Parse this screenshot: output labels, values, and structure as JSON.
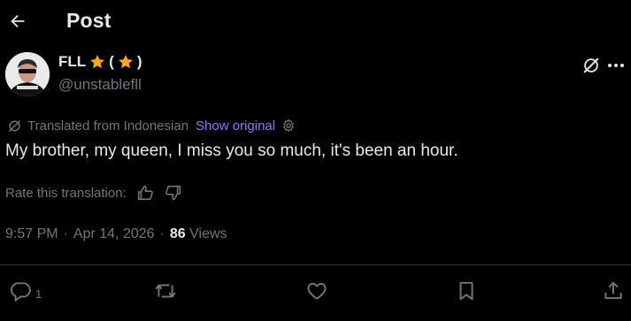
{
  "header": {
    "title": "Post"
  },
  "author": {
    "name": "FLL",
    "name_paren_open": "(",
    "name_paren_close": ")",
    "handle": "@unstablefll"
  },
  "translation": {
    "note": "Translated from Indonesian",
    "show_original": "Show original"
  },
  "tweet": {
    "text": "My brother, my queen, I miss you so much, it's been an hour."
  },
  "rating": {
    "label": "Rate this translation:"
  },
  "meta": {
    "time": "9:57 PM",
    "date": "Apr 14, 2026",
    "separator": "·",
    "views_count": "86",
    "views_label": "Views"
  },
  "actions": {
    "reply_count": "1"
  },
  "colors": {
    "background": "#000000",
    "text": "#e7e9ea",
    "muted": "#71767b",
    "link": "#8b7cf6",
    "star": "#f5a623",
    "divider": "#2f3336"
  }
}
